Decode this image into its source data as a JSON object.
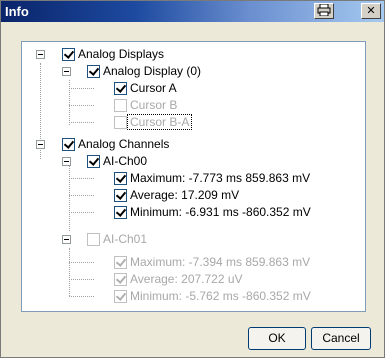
{
  "window": {
    "title": "Info"
  },
  "titlebar": {
    "print_icon": "printer-icon",
    "close_icon": "close-icon",
    "close_glyph": "✕"
  },
  "tree": {
    "analog_displays": {
      "label": "Analog Displays",
      "checked": true
    },
    "analog_display_0": {
      "label": "Analog Display (0)",
      "checked": true
    },
    "cursor_a": {
      "label": "Cursor A",
      "checked": true
    },
    "cursor_b": {
      "label": "Cursor B",
      "checked": false
    },
    "cursor_ba": {
      "label": "Cursor B-A",
      "checked": false
    },
    "analog_channels": {
      "label": "Analog Channels",
      "checked": true
    },
    "ai_ch00": {
      "label": "AI-Ch00",
      "checked": true
    },
    "ch00_max": {
      "label": "Maximum:  -7.773 ms  859.863 mV",
      "checked": true
    },
    "ch00_avg": {
      "label": "Average:  17.209 mV",
      "checked": true
    },
    "ch00_min": {
      "label": "Minimum:  -6.931 ms  -860.352 mV",
      "checked": true
    },
    "ai_ch01": {
      "label": "AI-Ch01",
      "checked": false
    },
    "ch01_max": {
      "label": "Maximum:  -7.394 ms  859.863 mV",
      "checked": true
    },
    "ch01_avg": {
      "label": "Average:  207.722 uV",
      "checked": true
    },
    "ch01_min": {
      "label": "Minimum:  -5.762 ms  -860.352 mV",
      "checked": true
    }
  },
  "buttons": {
    "ok": "OK",
    "cancel": "Cancel"
  }
}
